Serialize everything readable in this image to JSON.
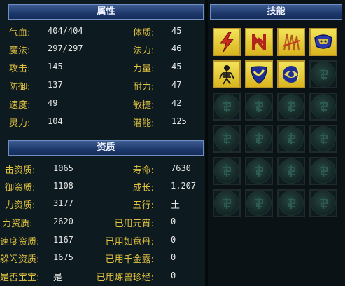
{
  "attributes": {
    "title": "属性",
    "rows": [
      {
        "l_label": "气血:",
        "l_value": "404/404",
        "r_label": "体质:",
        "r_value": "45"
      },
      {
        "l_label": "魔法:",
        "l_value": "297/297",
        "r_label": "法力:",
        "r_value": "46"
      },
      {
        "l_label": "攻击:",
        "l_value": "145",
        "r_label": "力量:",
        "r_value": "45"
      },
      {
        "l_label": "防御:",
        "l_value": "137",
        "r_label": "耐力:",
        "r_value": "47"
      },
      {
        "l_label": "速度:",
        "l_value": "49",
        "r_label": "敏捷:",
        "r_value": "42"
      },
      {
        "l_label": "灵力:",
        "l_value": "104",
        "r_label": "潜能:",
        "r_value": "125"
      }
    ]
  },
  "qualifications": {
    "title": "资质",
    "rows": [
      {
        "l_label": "击资质:",
        "l_value": "1065",
        "r_label": "寿命:",
        "r_value": "7630"
      },
      {
        "l_label": "御资质:",
        "l_value": "1108",
        "r_label": "成长:",
        "r_value": "1.207"
      },
      {
        "l_label": "力资质:",
        "l_value": "3177",
        "r_label": "五行:",
        "r_value": "土"
      },
      {
        "l_label": "力资质:",
        "l_value": "2620",
        "r_label": "已用元宵:",
        "r_value": "0"
      },
      {
        "l_label": "速度资质:",
        "l_value": "1167",
        "r_label": "已用如意丹:",
        "r_value": "0"
      },
      {
        "l_label": "躲闪资质:",
        "l_value": "1675",
        "r_label": "已用千金露:",
        "r_value": "0"
      },
      {
        "l_label": "是否宝宝:",
        "l_value": "是",
        "r_label": "已用炼兽珍经:",
        "r_value": "0"
      }
    ]
  },
  "skills": {
    "title": "技能",
    "items": [
      {
        "icon": "lightning-skill-icon"
      },
      {
        "icon": "rune-skill-icon"
      },
      {
        "icon": "flame-skill-icon"
      },
      {
        "icon": "dragon-skill-icon"
      },
      {
        "icon": "skeleton-skill-icon"
      },
      {
        "icon": "shield-skill-icon"
      },
      {
        "icon": "eye-skill-icon"
      }
    ],
    "empty_slot_icon": "empty-slot-icon",
    "slot_count": 24
  }
}
